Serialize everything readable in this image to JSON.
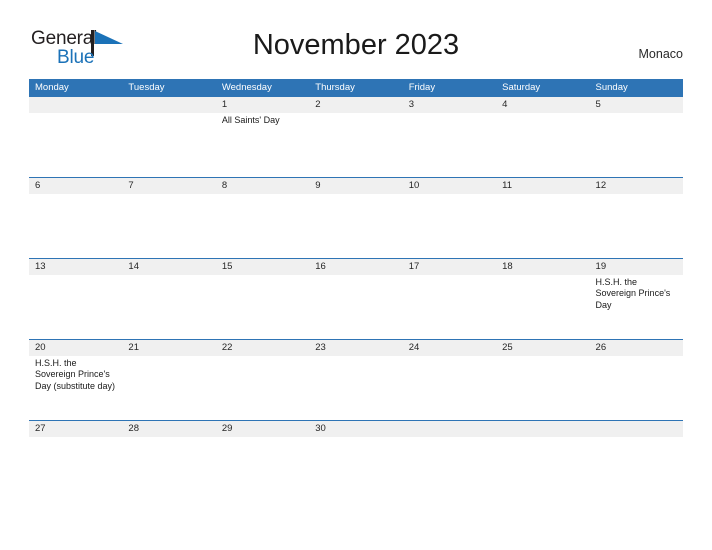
{
  "brand": {
    "name_part1": "General",
    "name_part2": "Blue",
    "flag_icon": "blue-flag-icon",
    "colors": {
      "dark": "#231f20",
      "blue": "#1b72b8"
    }
  },
  "header": {
    "title": "November 2023",
    "country": "Monaco",
    "accent_color": "#2e74b5",
    "band_color": "#f0f0f0"
  },
  "calendar": {
    "weekday_headers": [
      "Monday",
      "Tuesday",
      "Wednesday",
      "Thursday",
      "Friday",
      "Saturday",
      "Sunday"
    ],
    "weeks": [
      [
        {
          "day": "",
          "event": ""
        },
        {
          "day": "",
          "event": ""
        },
        {
          "day": "1",
          "event": "All Saints' Day"
        },
        {
          "day": "2",
          "event": ""
        },
        {
          "day": "3",
          "event": ""
        },
        {
          "day": "4",
          "event": ""
        },
        {
          "day": "5",
          "event": ""
        }
      ],
      [
        {
          "day": "6",
          "event": ""
        },
        {
          "day": "7",
          "event": ""
        },
        {
          "day": "8",
          "event": ""
        },
        {
          "day": "9",
          "event": ""
        },
        {
          "day": "10",
          "event": ""
        },
        {
          "day": "11",
          "event": ""
        },
        {
          "day": "12",
          "event": ""
        }
      ],
      [
        {
          "day": "13",
          "event": ""
        },
        {
          "day": "14",
          "event": ""
        },
        {
          "day": "15",
          "event": ""
        },
        {
          "day": "16",
          "event": ""
        },
        {
          "day": "17",
          "event": ""
        },
        {
          "day": "18",
          "event": ""
        },
        {
          "day": "19",
          "event": "H.S.H. the Sovereign Prince's Day"
        }
      ],
      [
        {
          "day": "20",
          "event": "H.S.H. the Sovereign Prince's Day (substitute day)"
        },
        {
          "day": "21",
          "event": ""
        },
        {
          "day": "22",
          "event": ""
        },
        {
          "day": "23",
          "event": ""
        },
        {
          "day": "24",
          "event": ""
        },
        {
          "day": "25",
          "event": ""
        },
        {
          "day": "26",
          "event": ""
        }
      ],
      [
        {
          "day": "27",
          "event": ""
        },
        {
          "day": "28",
          "event": ""
        },
        {
          "day": "29",
          "event": ""
        },
        {
          "day": "30",
          "event": ""
        },
        {
          "day": "",
          "event": ""
        },
        {
          "day": "",
          "event": ""
        },
        {
          "day": "",
          "event": ""
        }
      ]
    ]
  }
}
